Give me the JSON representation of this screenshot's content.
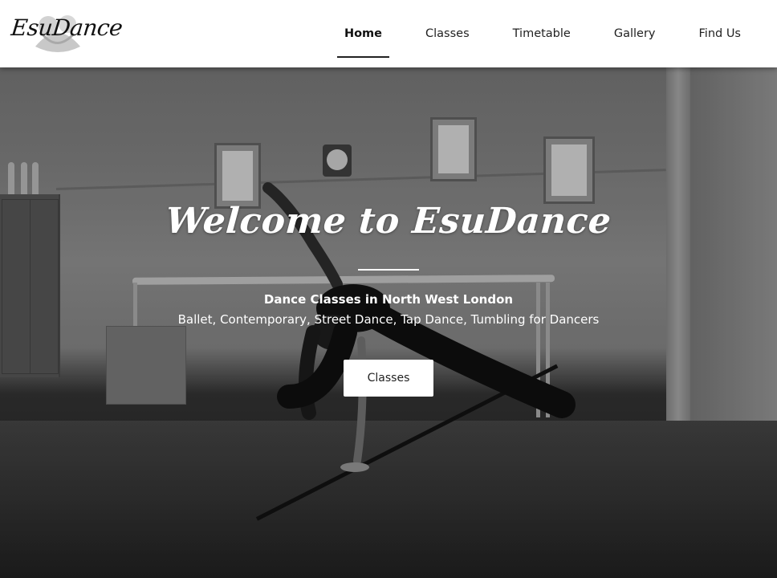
{
  "brand": {
    "name": "EsuDance"
  },
  "nav": {
    "items": [
      {
        "label": "Home",
        "active": true
      },
      {
        "label": "Classes",
        "active": false
      },
      {
        "label": "Timetable",
        "active": false
      },
      {
        "label": "Gallery",
        "active": false
      },
      {
        "label": "Find Us",
        "active": false
      }
    ]
  },
  "hero": {
    "title": "Welcome to EsuDance",
    "subtitle": "Dance Classes in North West London",
    "tagline": "Ballet, Contemporary, Street Dance, Tap Dance, Tumbling for Dancers",
    "cta_label": "Classes"
  },
  "colors": {
    "header_bg": "#ffffff",
    "hero_text": "#ffffff",
    "button_bg": "#ffffff"
  }
}
